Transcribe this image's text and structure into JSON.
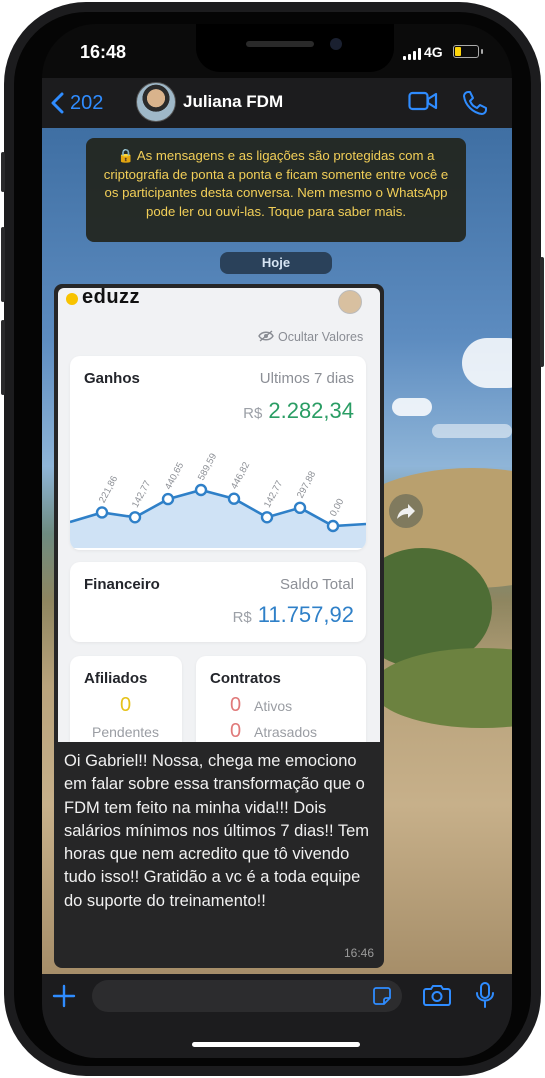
{
  "status": {
    "time": "16:48",
    "network": "4G",
    "battery_level": 0.3
  },
  "header": {
    "back_count": "202",
    "contact_name": "Juliana FDM"
  },
  "chat": {
    "encryption_notice": "🔒 As mensagens e as ligações são protegidas com a criptografia de ponta a ponta e ficam somente entre você e os participantes desta conversa. Nem mesmo o WhatsApp pode ler ou ouvi-las. Toque para saber mais.",
    "date_label": "Hoje",
    "message": {
      "text": "Oi Gabriel!! Nossa, chega me emociono em falar sobre essa transformação que o FDM tem feito na minha vida!!! Dois salários mínimos nos últimos 7 dias!! Tem horas que nem acredito que tô vivendo tudo isso!! Gratidão a vc é a toda equipe do suporte do treinamento!!",
      "time": "16:46"
    }
  },
  "screenshot": {
    "brand": "eduzz",
    "hide_values": "Ocultar Valores",
    "earnings": {
      "title": "Ganhos",
      "period": "Ultimos 7 dias",
      "currency": "R$",
      "amount": "2.282,34"
    },
    "financial": {
      "title": "Financeiro",
      "subtitle": "Saldo Total",
      "currency": "R$",
      "amount": "11.757,92"
    },
    "affiliates": {
      "title": "Afiliados",
      "count": "0",
      "label": "Pendentes"
    },
    "contracts": {
      "title": "Contratos",
      "active_count": "0",
      "active_label": "Ativos",
      "late_count": "0",
      "late_label": "Atrasados"
    }
  },
  "chart_data": {
    "type": "area",
    "point_labels": [
      "221,86",
      "142,77",
      "440,65",
      "589,59",
      "446,82",
      "142,77",
      "297,88",
      "0,00"
    ],
    "values": [
      221.86,
      142.77,
      440.65,
      589.59,
      446.82,
      142.77,
      297.88,
      0.0
    ],
    "xlabel": "",
    "ylabel": "",
    "grid": false,
    "colors": {
      "line": "#2f80c8",
      "fill": "#cfe2f5"
    }
  },
  "colors": {
    "accent": "#2f8cff",
    "earnings": "#2a9d64",
    "balance": "#2f80c8",
    "pending": "#e6c21a",
    "contracts": "#e07a7a",
    "notice_text": "#f2cf58"
  }
}
